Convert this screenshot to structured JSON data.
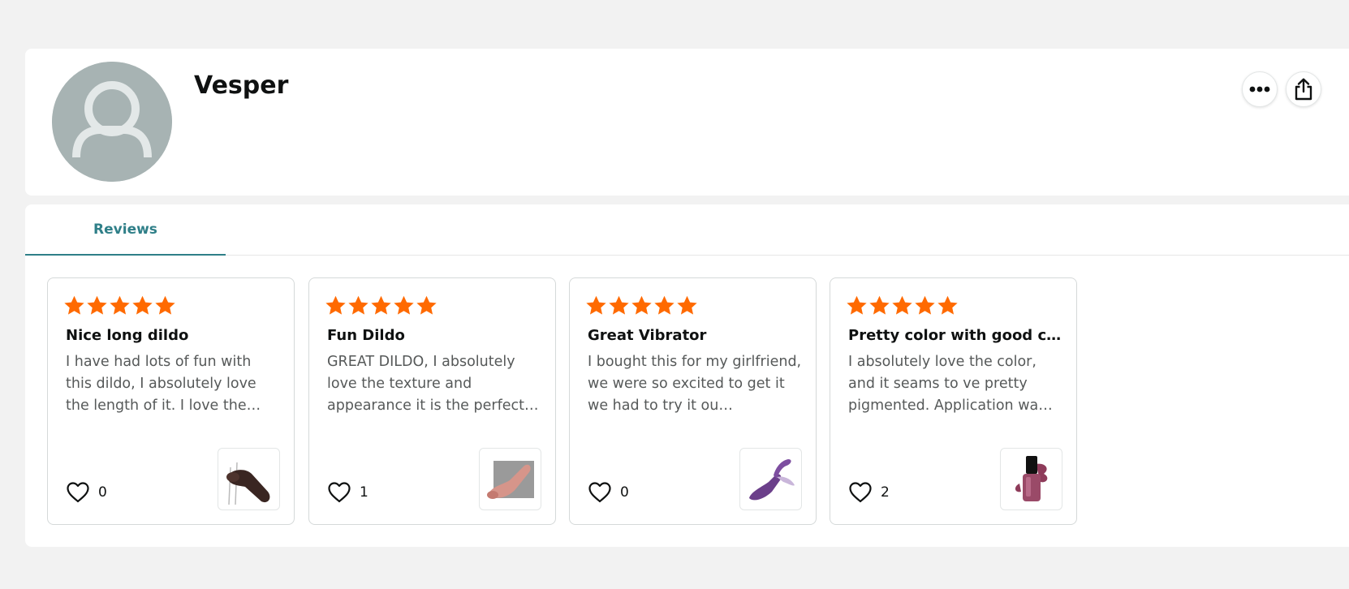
{
  "profile": {
    "name": "Vesper",
    "avatar_icon": "default-user-avatar",
    "actions": [
      {
        "name": "more-options",
        "icon": "more-horizontal-icon"
      },
      {
        "name": "share",
        "icon": "share-icon"
      }
    ]
  },
  "tabs": [
    {
      "label": "Reviews",
      "active": true
    }
  ],
  "colors": {
    "accent": "#2f7f88",
    "star": "#ff6a00",
    "avatar_bg": "#a7b3b3"
  },
  "reviews": [
    {
      "rating": 5,
      "title": "Nice long dildo",
      "body": "I have had lots of fun with this dildo, I absolutely love the length of it. I love the…",
      "likes": "0",
      "thumbnail": "product-thumbnail-dark-brown"
    },
    {
      "rating": 5,
      "title": "Fun Dildo",
      "body": "GREAT DILDO, I absolutely love the texture and appearance it is the perfect…",
      "likes": "1",
      "thumbnail": "product-thumbnail-pink"
    },
    {
      "rating": 5,
      "title": "Great Vibrator",
      "body": "I bought this for my girlfriend, we were so excited to get it we had to try it ou…",
      "likes": "0",
      "thumbnail": "product-thumbnail-purple-vibrator"
    },
    {
      "rating": 5,
      "title": "Pretty color with good c…",
      "body": "I absolutely love the color, and it seams to ve pretty pigmented. Application wa…",
      "likes": "2",
      "thumbnail": "product-thumbnail-nail-polish"
    }
  ]
}
